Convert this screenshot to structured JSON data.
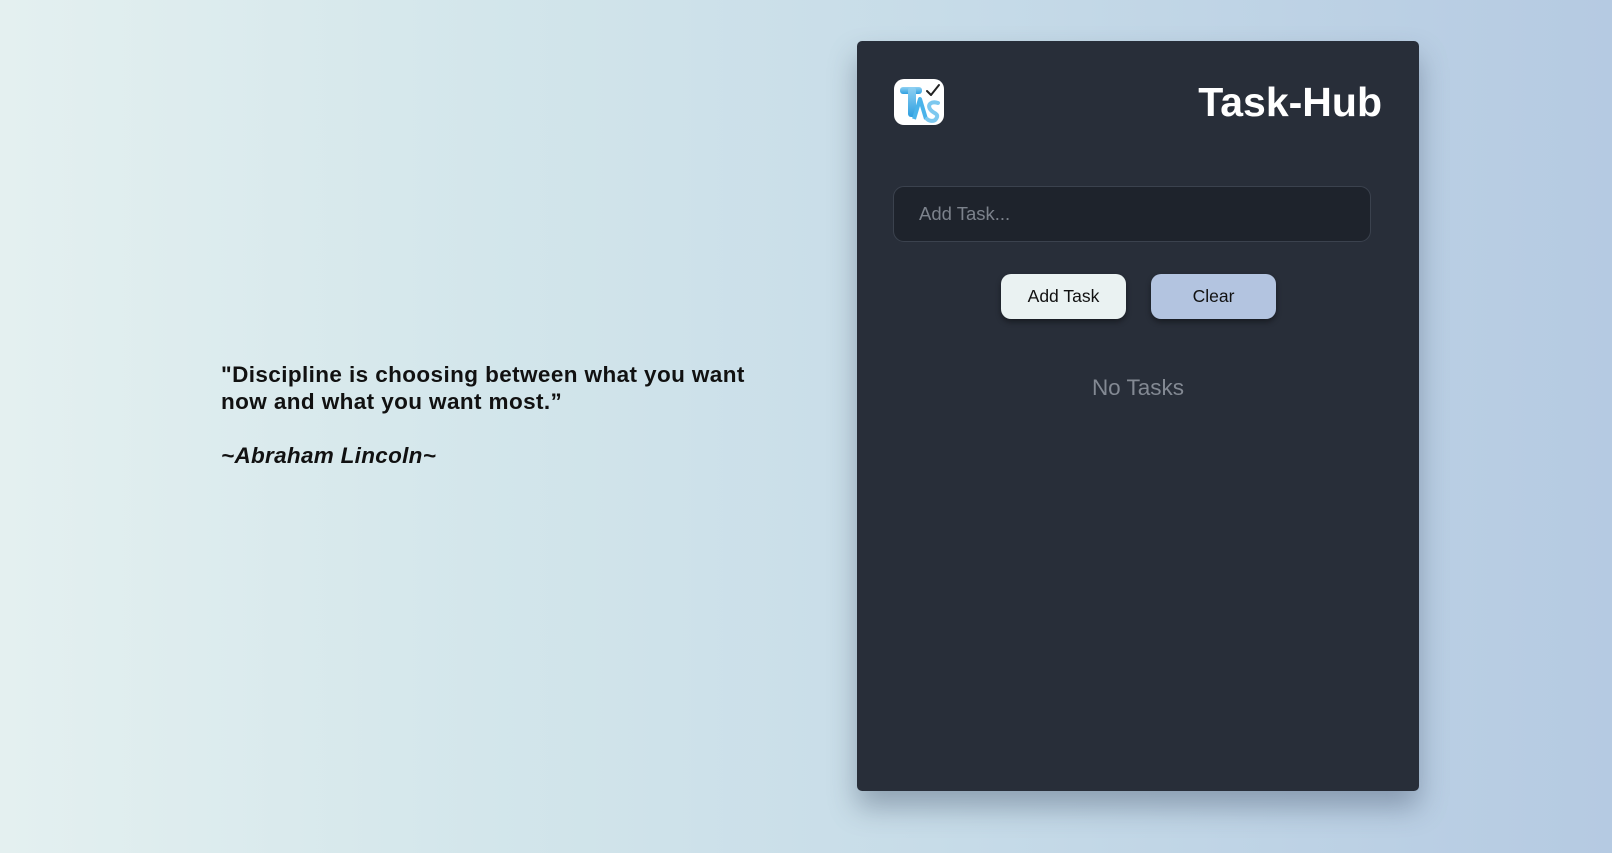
{
  "quote": {
    "text": "\"Discipline is choosing between what you want now and what you want most.”",
    "author": "~Abraham Lincoln~"
  },
  "app": {
    "title": "Task-Hub",
    "logo_icon": "task-hub-logo"
  },
  "form": {
    "placeholder": "Add Task...",
    "value": "",
    "add_label": "Add Task",
    "clear_label": "Clear"
  },
  "tasks": {
    "items": [],
    "empty_text": "No Tasks"
  },
  "colors": {
    "panel_bg": "#282e39",
    "input_bg": "#1e232c",
    "add_button": "#eaf2f2",
    "clear_button": "#b3c4e0",
    "title_text": "#ffffff"
  }
}
